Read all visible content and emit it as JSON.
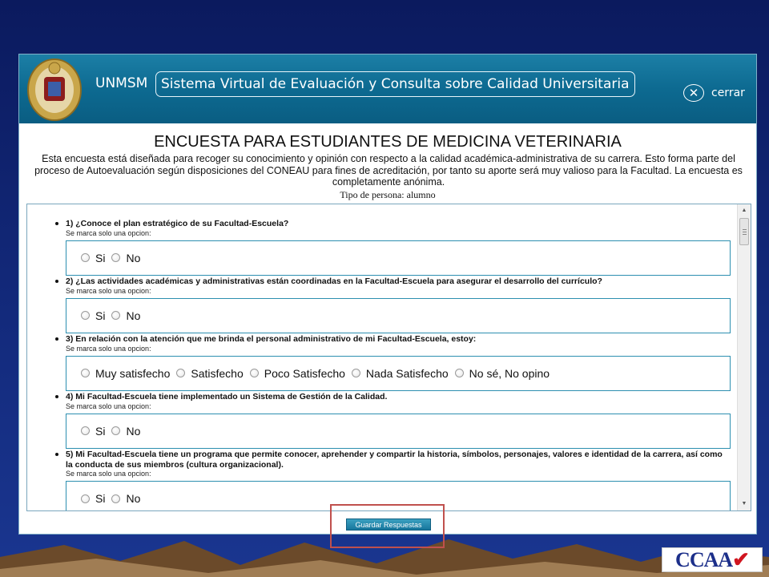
{
  "header": {
    "brand": "UNMSM",
    "system_title": "Sistema Virtual de Evaluación y Consulta sobre Calidad Universitaria",
    "close_label": "cerrar"
  },
  "survey": {
    "title": "ENCUESTA PARA ESTUDIANTES DE MEDICINA VETERINARIA",
    "intro": "Esta encuesta está diseñada para recoger su conocimiento y opinión con respecto a la calidad académica-administrativa de su carrera. Esto forma parte del proceso de Autoevaluación según disposiciones del CONEAU para fines de acreditación, por tanto su aporte será muy valioso para la Facultad. La encuesta es completamente anónima.",
    "person_type": "Tipo de persona: alumno",
    "hint": "Se marca solo una opcion:",
    "questions": [
      {
        "text": "1) ¿Conoce el plan estratégico de su Facultad-Escuela?",
        "options": [
          "Si",
          "No"
        ]
      },
      {
        "text": "2) ¿Las actividades académicas y administrativas están coordinadas en la Facultad-Escuela para asegurar el desarrollo del currículo?",
        "options": [
          "Si",
          "No"
        ]
      },
      {
        "text": "3) En relación con la atención que me brinda el personal administrativo de mi Facultad-Escuela, estoy:",
        "options": [
          "Muy satisfecho",
          "Satisfecho",
          "Poco Satisfecho",
          "Nada Satisfecho",
          "No sé, No opino"
        ]
      },
      {
        "text": "4) Mi Facultad-Escuela tiene implementado un Sistema de Gestión de la Calidad.",
        "options": [
          "Si",
          "No"
        ]
      },
      {
        "text": "5) Mi Facultad-Escuela tiene un programa que permite conocer, aprehender y compartir la historia, símbolos, personajes, valores e identidad de la carrera, así como la conducta de sus miembros (cultura organizacional).",
        "options": [
          "Si",
          "No"
        ]
      }
    ],
    "save_label": "Guardar Respuestas"
  },
  "footer_logo": {
    "text": "CCAA",
    "check": "✔"
  },
  "colors": {
    "header": "#0d6a91",
    "highlight": "#c0504d",
    "background": "#132a7c"
  }
}
